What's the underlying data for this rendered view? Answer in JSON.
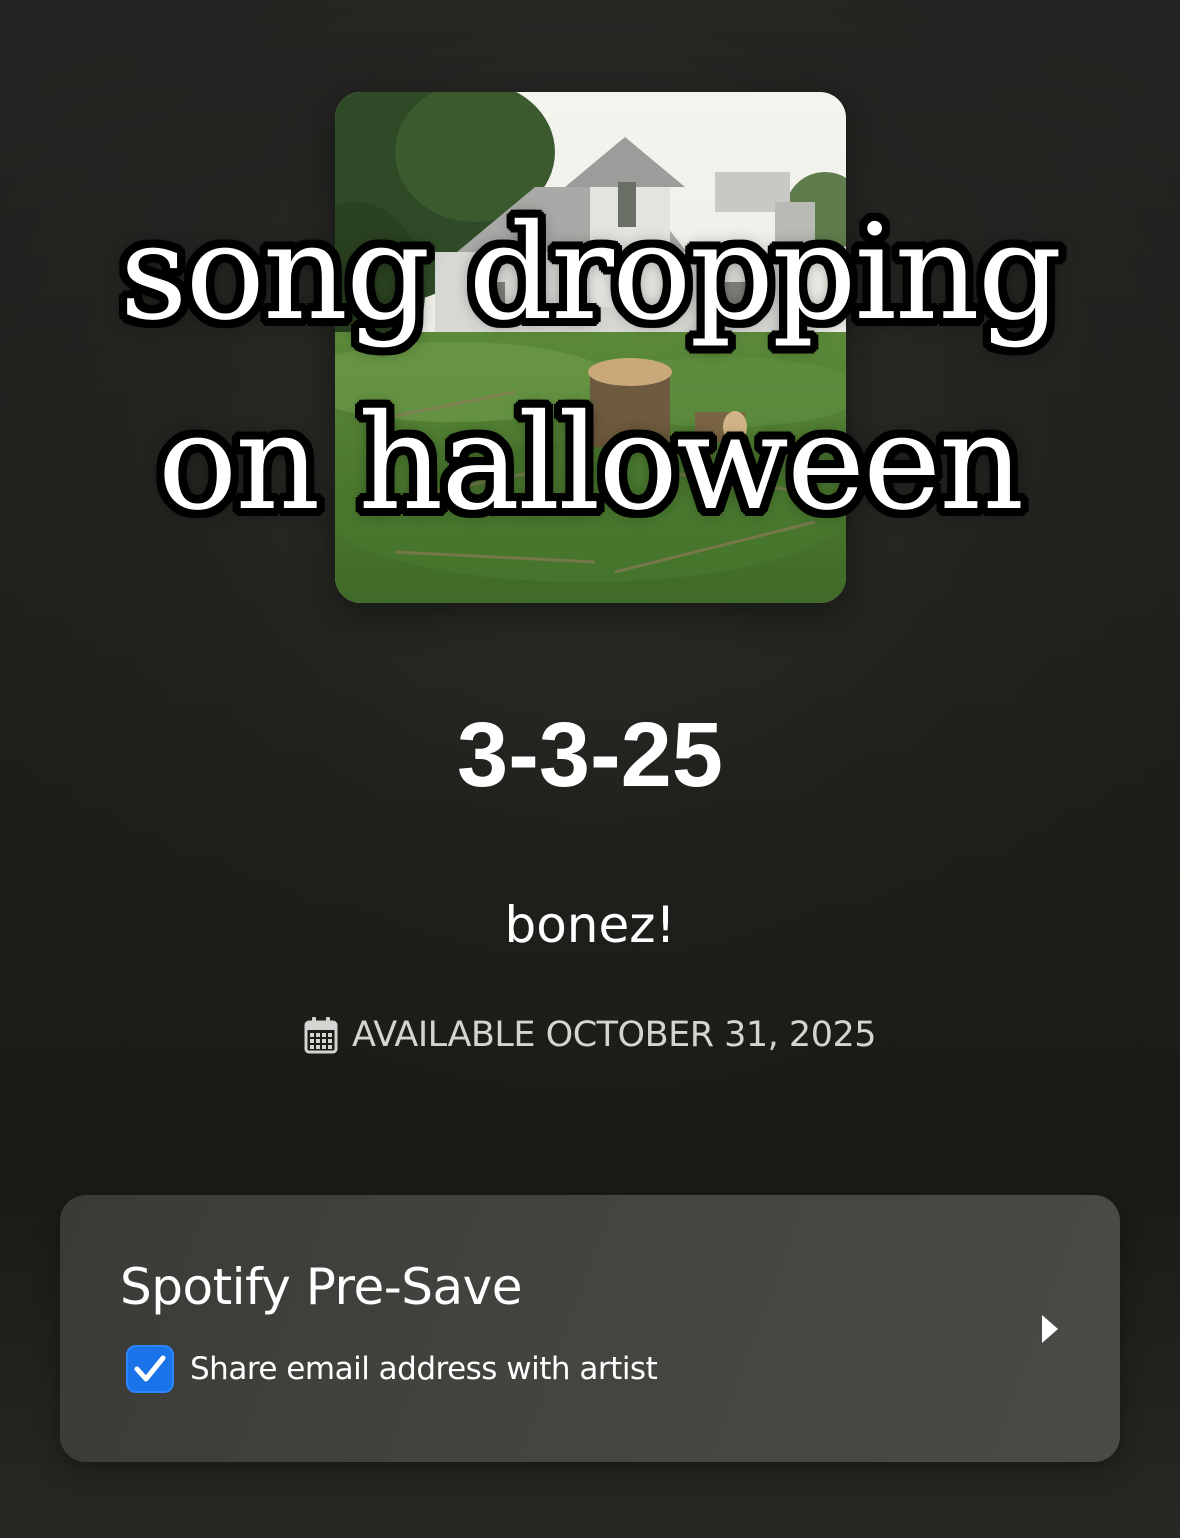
{
  "cover": {
    "caption_line_1": "song dropping",
    "caption_line_2": "on halloween"
  },
  "release": {
    "title": "3-3-25",
    "artist": "bonez!",
    "availability": "AVAILABLE OCTOBER 31, 2025",
    "availability_icon": "calendar-icon"
  },
  "presave": {
    "title": "Spotify Pre-Save",
    "share_label": "Share email address with artist",
    "share_checked": true,
    "checkbox_color": "#1a73e8",
    "action_icon": "chevron-right-icon"
  }
}
